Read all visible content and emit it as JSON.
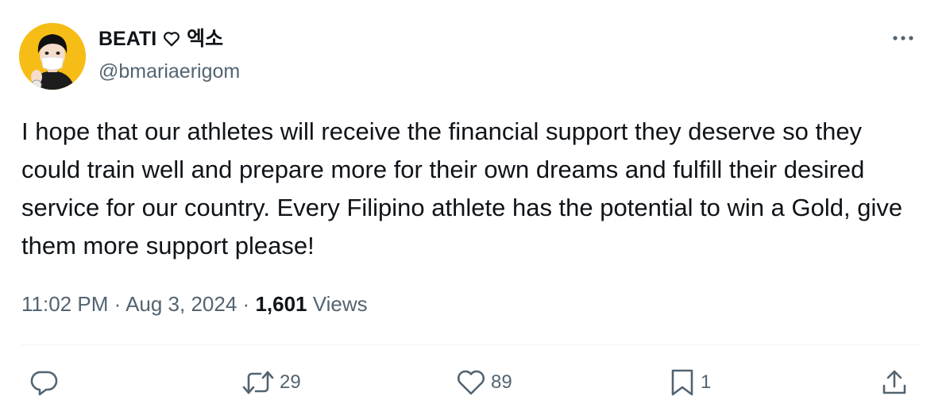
{
  "tweet": {
    "author": {
      "display_name": "BEATI",
      "name_suffix": "엑소",
      "handle": "@bmariaerigom"
    },
    "text": "I hope that our athletes will receive the financial support they deserve so they could train well and prepare more for their own dreams and fulfill their desired service for our country. Every Filipino athlete has the potential to win a Gold, give them more support please!",
    "meta": {
      "time": "11:02 PM",
      "separator": "·",
      "date": "Aug 3, 2024",
      "views_count": "1,601",
      "views_label": "Views"
    },
    "actions": {
      "reply_count": "",
      "retweet_count": "29",
      "like_count": "89",
      "bookmark_count": "1"
    }
  },
  "colors": {
    "avatar_bg": "#f6bd16",
    "muted_text": "#536471",
    "main_text": "#0f1419",
    "divider": "#eff3f4"
  },
  "icons": [
    "heart-icon",
    "more-icon",
    "reply-icon",
    "retweet-icon",
    "like-icon",
    "bookmark-icon",
    "share-icon"
  ]
}
